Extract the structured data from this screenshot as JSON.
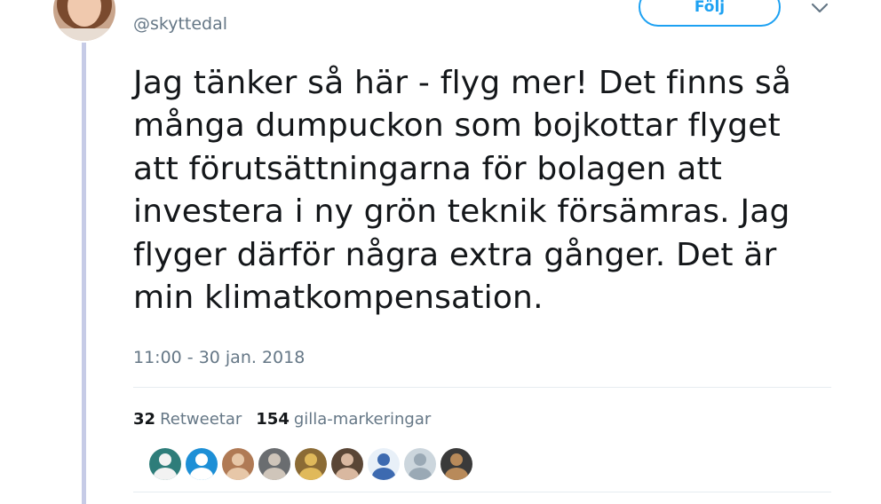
{
  "author": {
    "handle": "@skyttedal",
    "avatar_icon": "profile-photo-icon"
  },
  "follow_button": {
    "label": "Följ"
  },
  "menu": {
    "icon": "chevron-down-icon"
  },
  "tweet": {
    "text": "Jag tänker så här - flyg mer! Det finns så\nmånga dumpuckon som bojkottar flyget\natt förutsättningarna för bolagen att\ninvestera i ny grön teknik försämras. Jag\nflyger därför några extra gånger. Det är\nmin klimatkompensation.",
    "timestamp": "11:00 - 30 jan. 2018"
  },
  "stats": {
    "retweets_count": "32",
    "retweets_label": "Retweetar",
    "likes_count": "154",
    "likes_label": "gilla-markeringar"
  },
  "likers": [
    {
      "name": "liker-avatar-1",
      "bg": "#2e7d7a",
      "fg": "#f2f2f2"
    },
    {
      "name": "liker-avatar-2",
      "bg": "#1d8fd6",
      "fg": "#ffffff"
    },
    {
      "name": "liker-avatar-3",
      "bg": "#b07a55",
      "fg": "#e7c7a8"
    },
    {
      "name": "liker-avatar-4",
      "bg": "#6a6d70",
      "fg": "#cfc5ba"
    },
    {
      "name": "liker-avatar-5",
      "bg": "#8b6b35",
      "fg": "#e0b95a"
    },
    {
      "name": "liker-avatar-6",
      "bg": "#5a4636",
      "fg": "#d9b8a0"
    },
    {
      "name": "liker-avatar-7",
      "bg": "#e8f0f8",
      "fg": "#3d6ab0"
    },
    {
      "name": "liker-avatar-8",
      "bg": "#ccd6dd",
      "fg": "#9aa9b5"
    },
    {
      "name": "liker-avatar-9",
      "bg": "#3a3a3a",
      "fg": "#b88a5a"
    }
  ],
  "colors": {
    "accent": "#1da1f2",
    "secondary_text": "#657786",
    "thread_line": "#c6cbe6"
  }
}
